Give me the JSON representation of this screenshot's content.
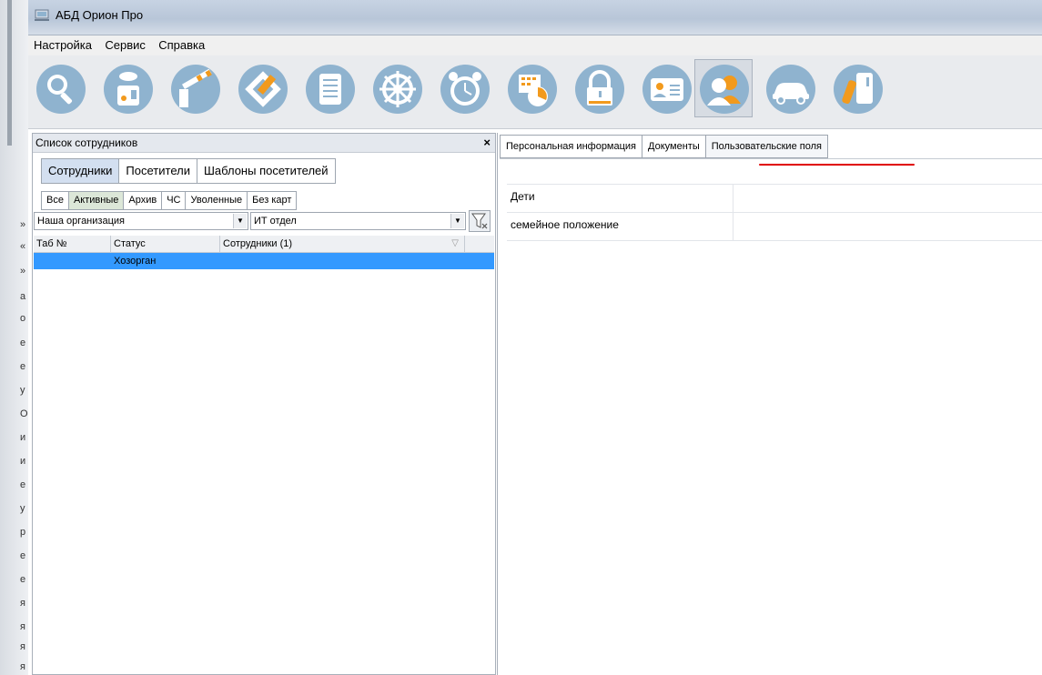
{
  "window": {
    "title": "АБД Орион Про"
  },
  "menu": [
    "Настройка",
    "Сервис",
    "Справка"
  ],
  "toolbar": {
    "buttons": [
      {
        "icon": "magnifier-search-icon"
      },
      {
        "icon": "reader-device-icon"
      },
      {
        "icon": "barrier-gate-icon"
      },
      {
        "icon": "floor-plan-icon"
      },
      {
        "icon": "document-list-icon"
      },
      {
        "icon": "helm-wheel-icon"
      },
      {
        "icon": "alarm-clock-icon"
      },
      {
        "icon": "schedule-chart-icon"
      },
      {
        "icon": "padlock-icon"
      },
      {
        "icon": "id-card-icon"
      },
      {
        "icon": "employees-icon",
        "active": true
      },
      {
        "icon": "car-icon"
      },
      {
        "icon": "key-card-icon"
      }
    ]
  },
  "left_panel": {
    "title": "Список сотрудников",
    "close": "×",
    "tabs": [
      "Сотрудники",
      "Посетители",
      "Шаблоны посетителей"
    ],
    "active_tab": 0,
    "filter_tabs": [
      "Все",
      "Активные",
      "Архив",
      "ЧС",
      "Уволенные",
      "Без карт"
    ],
    "active_filter_tab": 1,
    "organization": "Наша организация",
    "department": "ИТ отдел",
    "grid": {
      "columns": [
        "Таб №",
        "Статус",
        "Сотрудники (1)"
      ],
      "rows": [
        {
          "tab_no": "",
          "status": "Хозорган",
          "name": ""
        }
      ]
    }
  },
  "right_panel": {
    "tabs": [
      "Персональная информация",
      "Документы",
      "Пользовательские поля"
    ],
    "active_tab": 2,
    "fields": [
      {
        "label": "Дети",
        "value": ""
      },
      {
        "label": "семейное положение",
        "value": ""
      }
    ]
  },
  "background_strip_chars": [
    "»",
    "«",
    "»",
    "а",
    "о",
    "е",
    "е",
    "у",
    "О",
    "и",
    "и",
    "е",
    "у",
    "р",
    "е",
    "е",
    "я",
    "я",
    "я",
    "я"
  ],
  "colors": {
    "selection": "#3399ff",
    "active_tab": "#d3dff0",
    "active_filter": "#dce7d8",
    "underline": "#e00000",
    "icon_circle": "#8fb3cf"
  }
}
